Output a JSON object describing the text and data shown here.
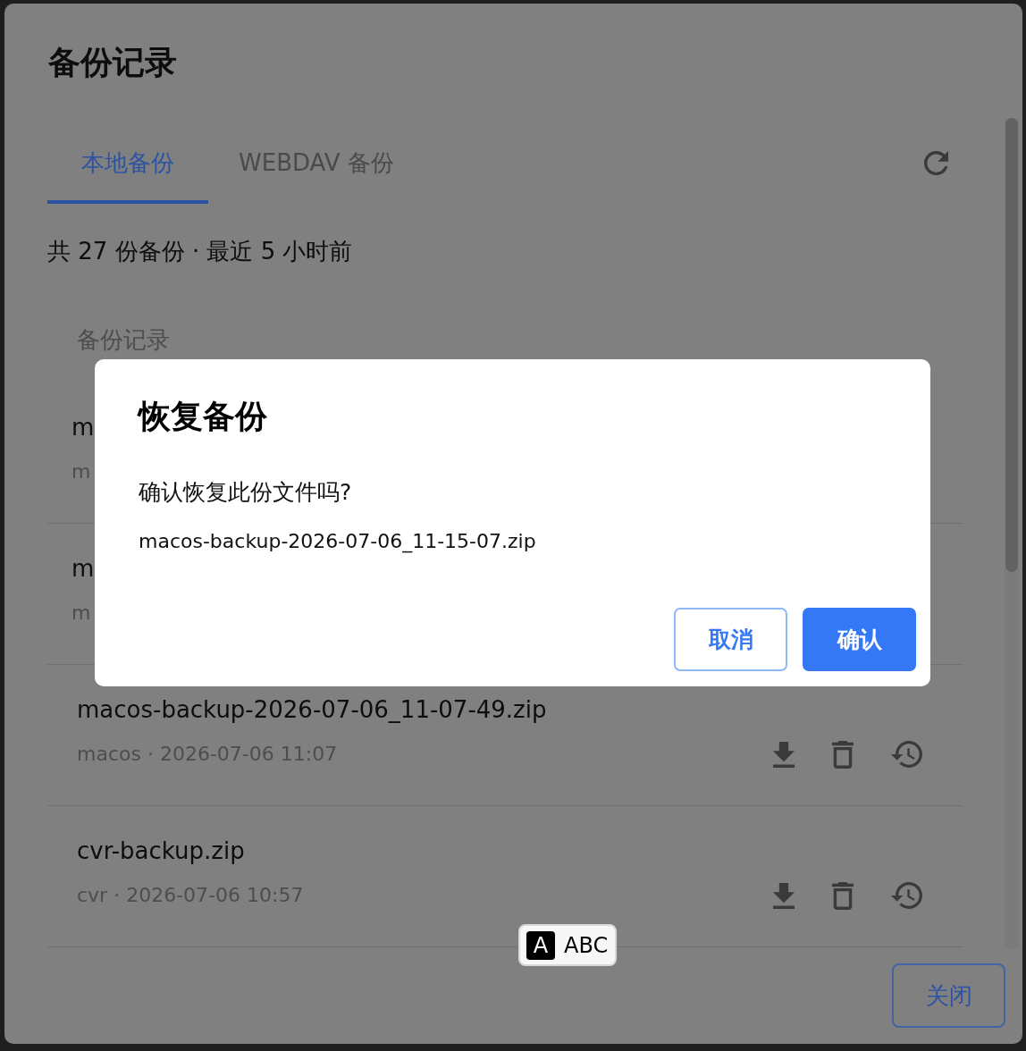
{
  "dialog": {
    "title": "备份记录",
    "tabs": [
      {
        "label": "本地备份",
        "selected": true
      },
      {
        "label": "WEBDAV 备份",
        "selected": false
      }
    ],
    "summary": "共 27 份备份 · 最近 5 小时前",
    "list_header": "备份记录",
    "covered_rows": [
      {
        "name": "m",
        "meta": "m"
      },
      {
        "name": "m",
        "meta": "m"
      }
    ],
    "rows": [
      {
        "name": "macos-backup-2026-07-06_11-07-49.zip",
        "meta": "macos · 2026-07-06 11:07"
      },
      {
        "name": "cvr-backup.zip",
        "meta": "cvr · 2026-07-06 10:57"
      }
    ],
    "close_button": "关闭"
  },
  "confirm_dialog": {
    "title": "恢复备份",
    "message": "确认恢复此份文件吗?",
    "filename": "macos-backup-2026-07-06_11-15-07.zip",
    "buttons": [
      {
        "label": "取消",
        "kind": "secondary"
      },
      {
        "label": "确认",
        "kind": "primary"
      }
    ]
  },
  "input_indicator": {
    "badge": "A",
    "label": "ABC"
  }
}
